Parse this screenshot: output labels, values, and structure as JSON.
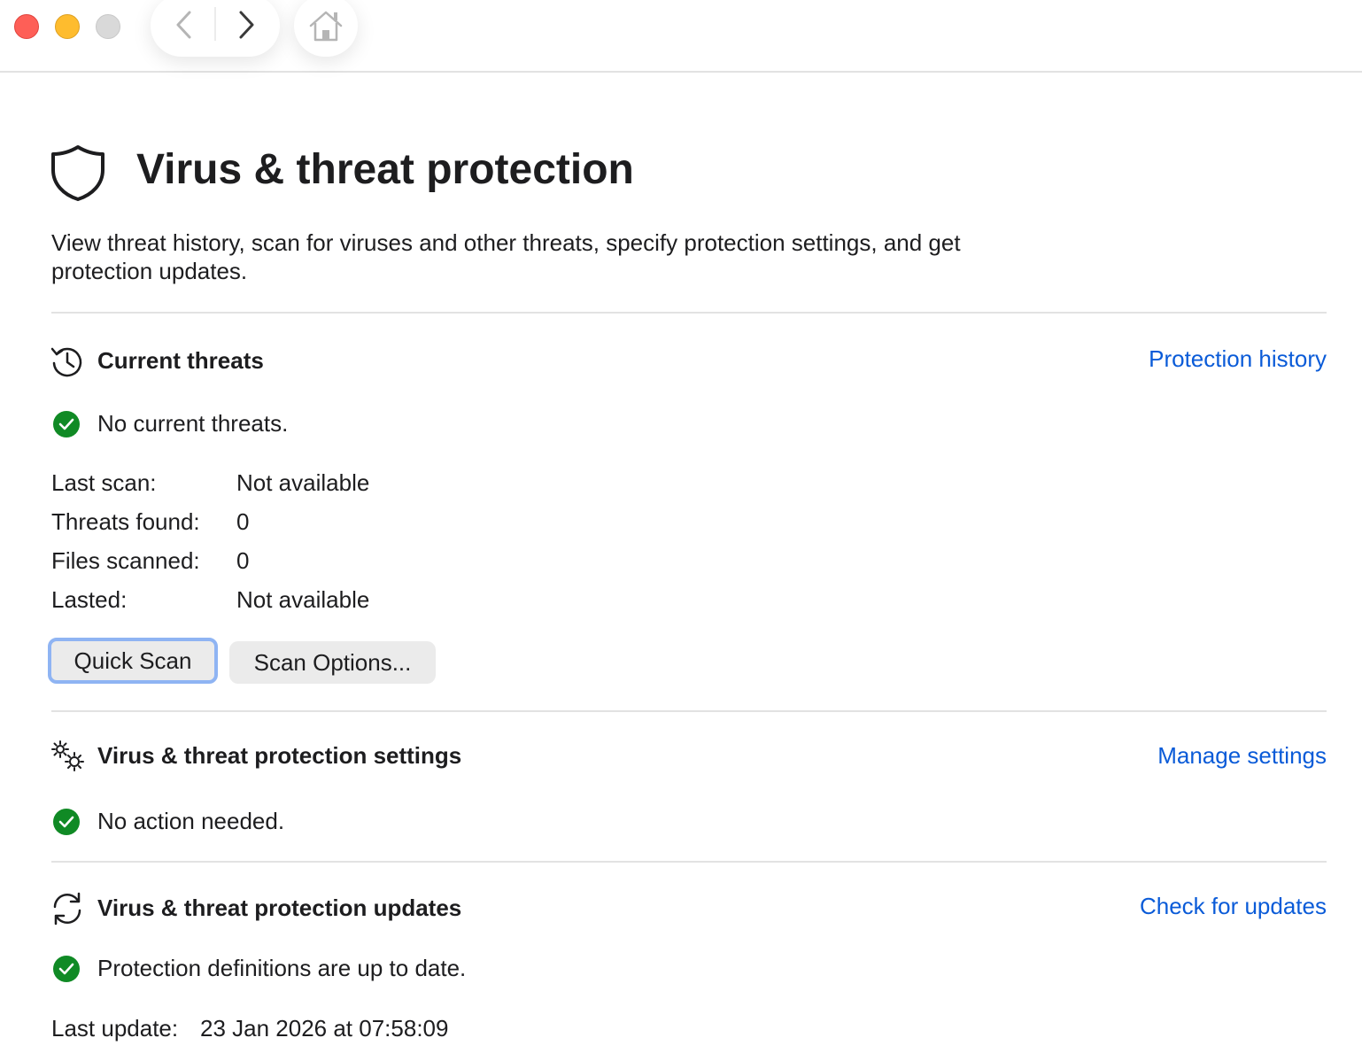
{
  "window": {
    "controls": [
      "close",
      "minimize",
      "zoom"
    ],
    "nav": {
      "back_icon": "chevron-left-icon",
      "forward_icon": "chevron-right-icon",
      "home_icon": "home-icon"
    }
  },
  "header": {
    "icon": "shield-icon",
    "title": "Virus & threat protection",
    "description": "View threat history, scan for viruses and other threats, specify protection settings, and get protection updates."
  },
  "current_threats": {
    "icon": "history-icon",
    "title": "Current threats",
    "link": "Protection history",
    "status": "No current threats.",
    "details": [
      {
        "label": "Last scan:",
        "value": "Not available"
      },
      {
        "label": "Threats found:",
        "value": "0"
      },
      {
        "label": "Files scanned:",
        "value": "0"
      },
      {
        "label": "Lasted:",
        "value": "Not available"
      }
    ],
    "buttons": {
      "quick_scan": "Quick Scan",
      "scan_options": "Scan Options..."
    }
  },
  "settings": {
    "icon": "gears-icon",
    "title": "Virus & threat protection settings",
    "link": "Manage settings",
    "status": "No action needed."
  },
  "updates": {
    "icon": "refresh-icon",
    "title": "Virus & threat protection updates",
    "link": "Check for updates",
    "status": "Protection definitions are up to date.",
    "last_update_label": "Last update:",
    "last_update_value": "23 Jan 2026 at 07:58:09"
  },
  "colors": {
    "link": "#0a5bd8",
    "success": "#108a25",
    "focus_ring": "#8fb4f3",
    "divider": "#e2e2e2"
  }
}
